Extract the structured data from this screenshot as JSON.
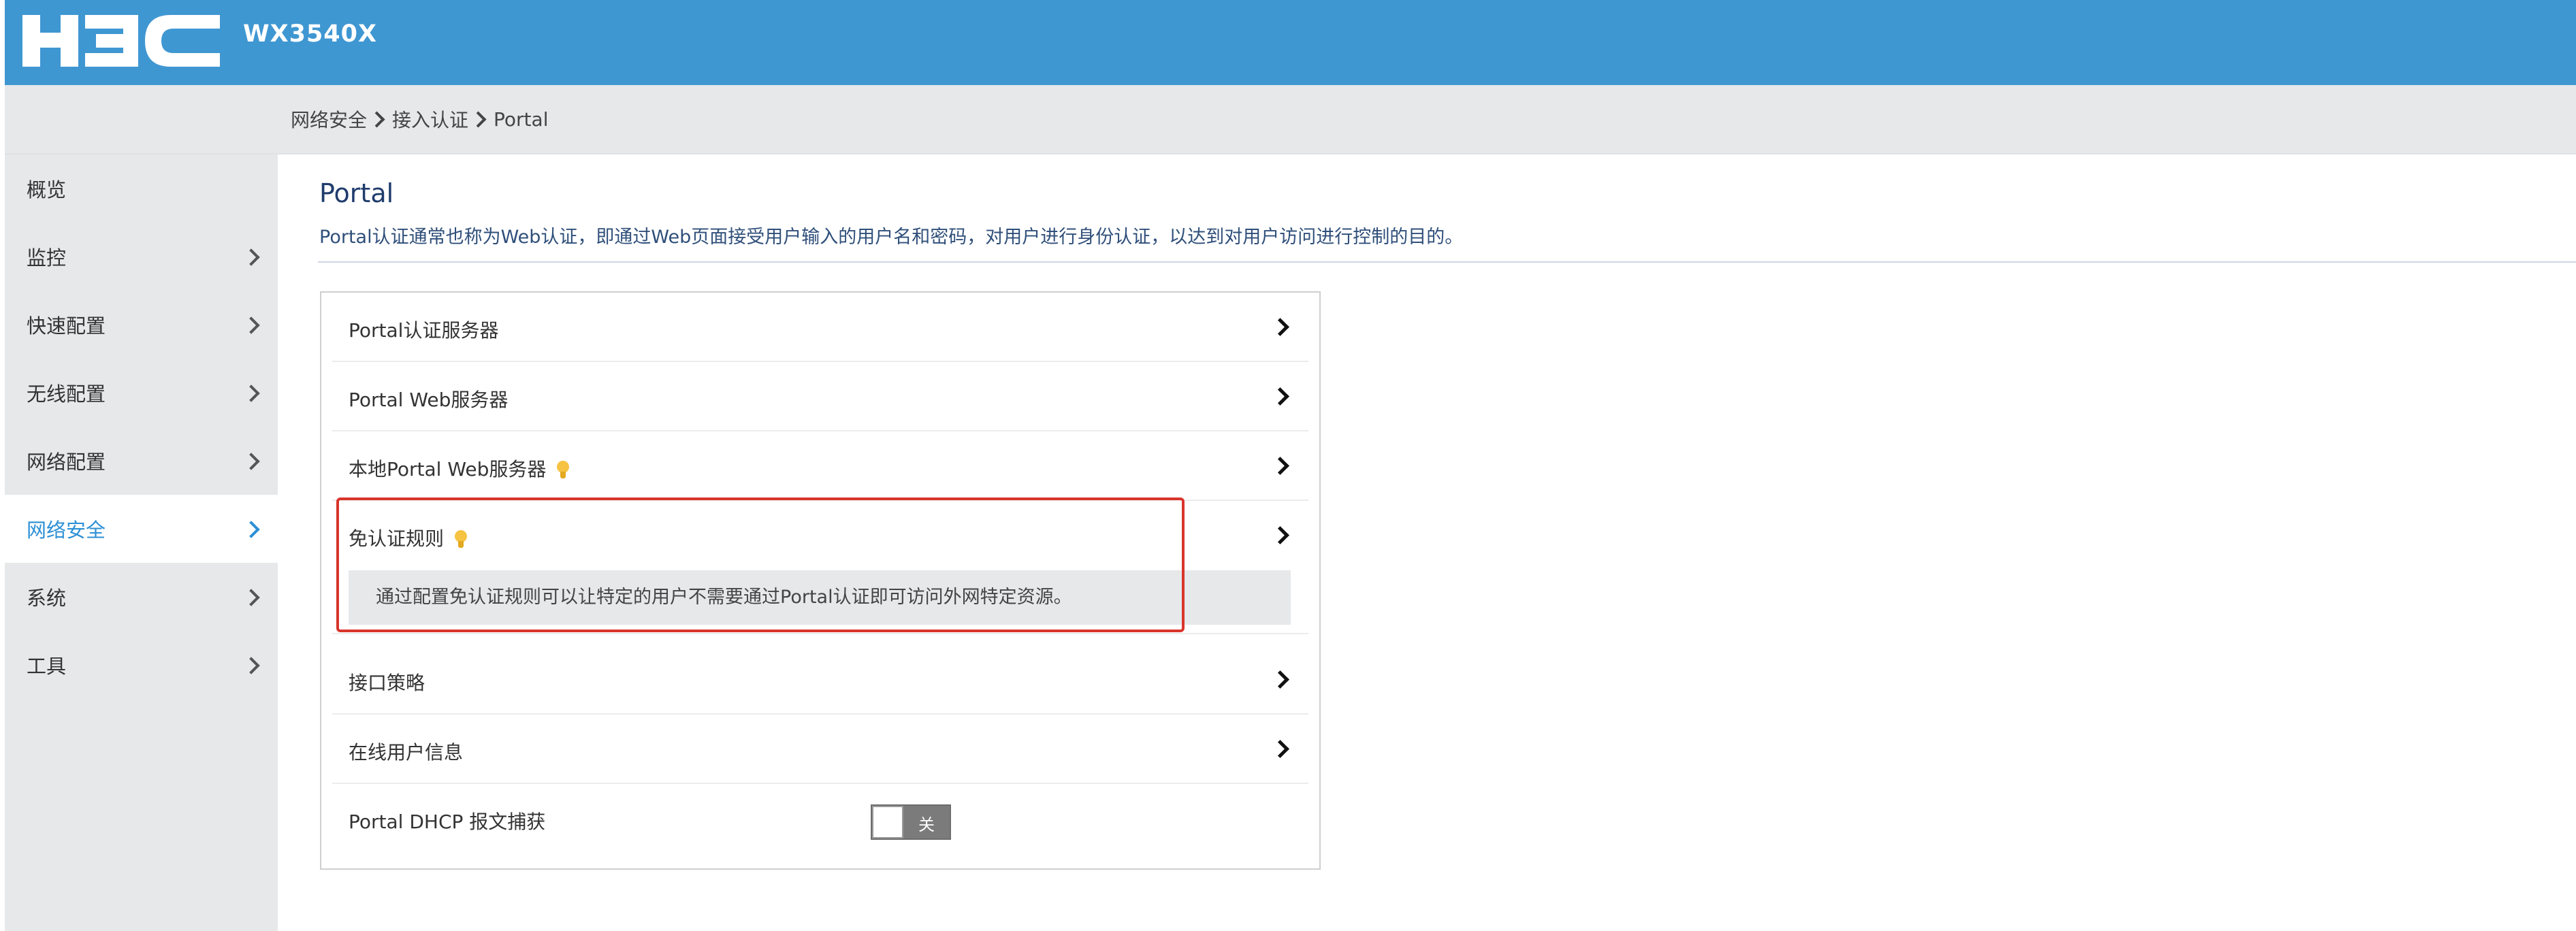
{
  "header": {
    "brand": "H3C",
    "model": "WX3540X"
  },
  "breadcrumb": [
    "网络安全",
    "接入认证",
    "Portal"
  ],
  "sidebar": {
    "items": [
      {
        "label": "概览",
        "has_chevron": false,
        "active": false
      },
      {
        "label": "监控",
        "has_chevron": true,
        "active": false
      },
      {
        "label": "快速配置",
        "has_chevron": true,
        "active": false
      },
      {
        "label": "无线配置",
        "has_chevron": true,
        "active": false
      },
      {
        "label": "网络配置",
        "has_chevron": true,
        "active": false
      },
      {
        "label": "网络安全",
        "has_chevron": true,
        "active": true
      },
      {
        "label": "系统",
        "has_chevron": true,
        "active": false
      },
      {
        "label": "工具",
        "has_chevron": true,
        "active": false
      }
    ]
  },
  "main": {
    "title": "Portal",
    "description": "Portal认证通常也称为Web认证，即通过Web页面接受用户输入的用户名和密码，对用户进行身份认证，以达到对用户访问进行控制的目的。",
    "rows": [
      {
        "label": "Portal认证服务器",
        "hint_icon": false
      },
      {
        "label": "Portal Web服务器",
        "hint_icon": false
      },
      {
        "label": "本地Portal Web服务器",
        "hint_icon": true
      },
      {
        "label": "免认证规则",
        "hint_icon": true
      },
      {
        "label": "接口策略",
        "hint_icon": false
      },
      {
        "label": "在线用户信息",
        "hint_icon": false
      }
    ],
    "tooltip": "通过配置免认证规则可以让特定的用户不需要通过Portal认证即可访问外网特定资源。",
    "dhcp_capture": {
      "label": "Portal DHCP 报文捕获",
      "toggle_state": "关"
    }
  },
  "colors": {
    "header_bg": "#3f97d2",
    "sidebar_bg": "#e6e8ea",
    "active_text": "#2d8fd5",
    "highlight_border": "#d9342b",
    "hint_bulb": "#f6c342"
  }
}
